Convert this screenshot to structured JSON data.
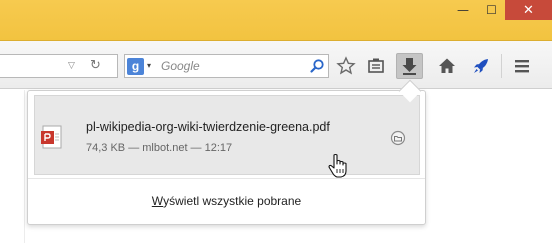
{
  "window": {
    "minimize_symbol": "—",
    "maximize_symbol": "☐",
    "close_symbol": "✕",
    "titlebar_color": "#f3c542",
    "close_color": "#c74a3a"
  },
  "toolbar": {
    "url_dropdown_symbol": "▽",
    "reload_symbol": "↻",
    "search": {
      "engine_letter": "g",
      "engine_arrow": "▾",
      "placeholder": "Google"
    },
    "icons": [
      "bookmark-star-icon",
      "reading-list-icon",
      "download-icon",
      "home-icon",
      "rocket-icon",
      "menu-icon"
    ]
  },
  "downloads_panel": {
    "item": {
      "filename": "pl-wikipedia-org-wiki-twierdzenie-greena.pdf",
      "meta": "74,3 KB — mlbot.net — 12:17",
      "file_type_icon": "pdf-file-icon"
    },
    "show_all_accesskey": "W",
    "show_all_rest": "yświetl wszystkie pobrane"
  }
}
